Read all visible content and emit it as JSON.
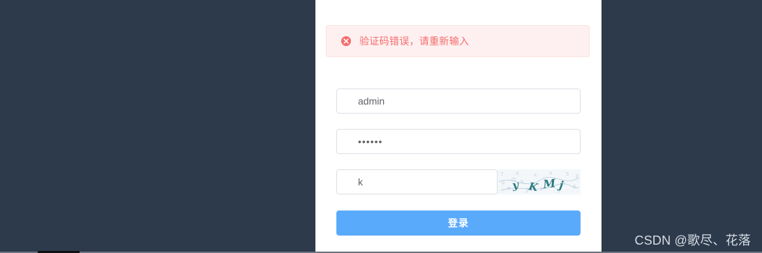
{
  "alert": {
    "message": "验证码错误，请重新输入",
    "icon": "error-circle-icon",
    "color": "#f56c6c"
  },
  "form": {
    "username_value": "admin",
    "password_value": "••••••",
    "code_value": "k",
    "captcha_text": "yKMj",
    "login_label": "登录"
  },
  "colors": {
    "background": "#2d3a4b",
    "panel": "#ffffff",
    "button": "#5aaafc",
    "alert_bg": "#fef0f0"
  },
  "watermark": "CSDN @歌尽、花落"
}
